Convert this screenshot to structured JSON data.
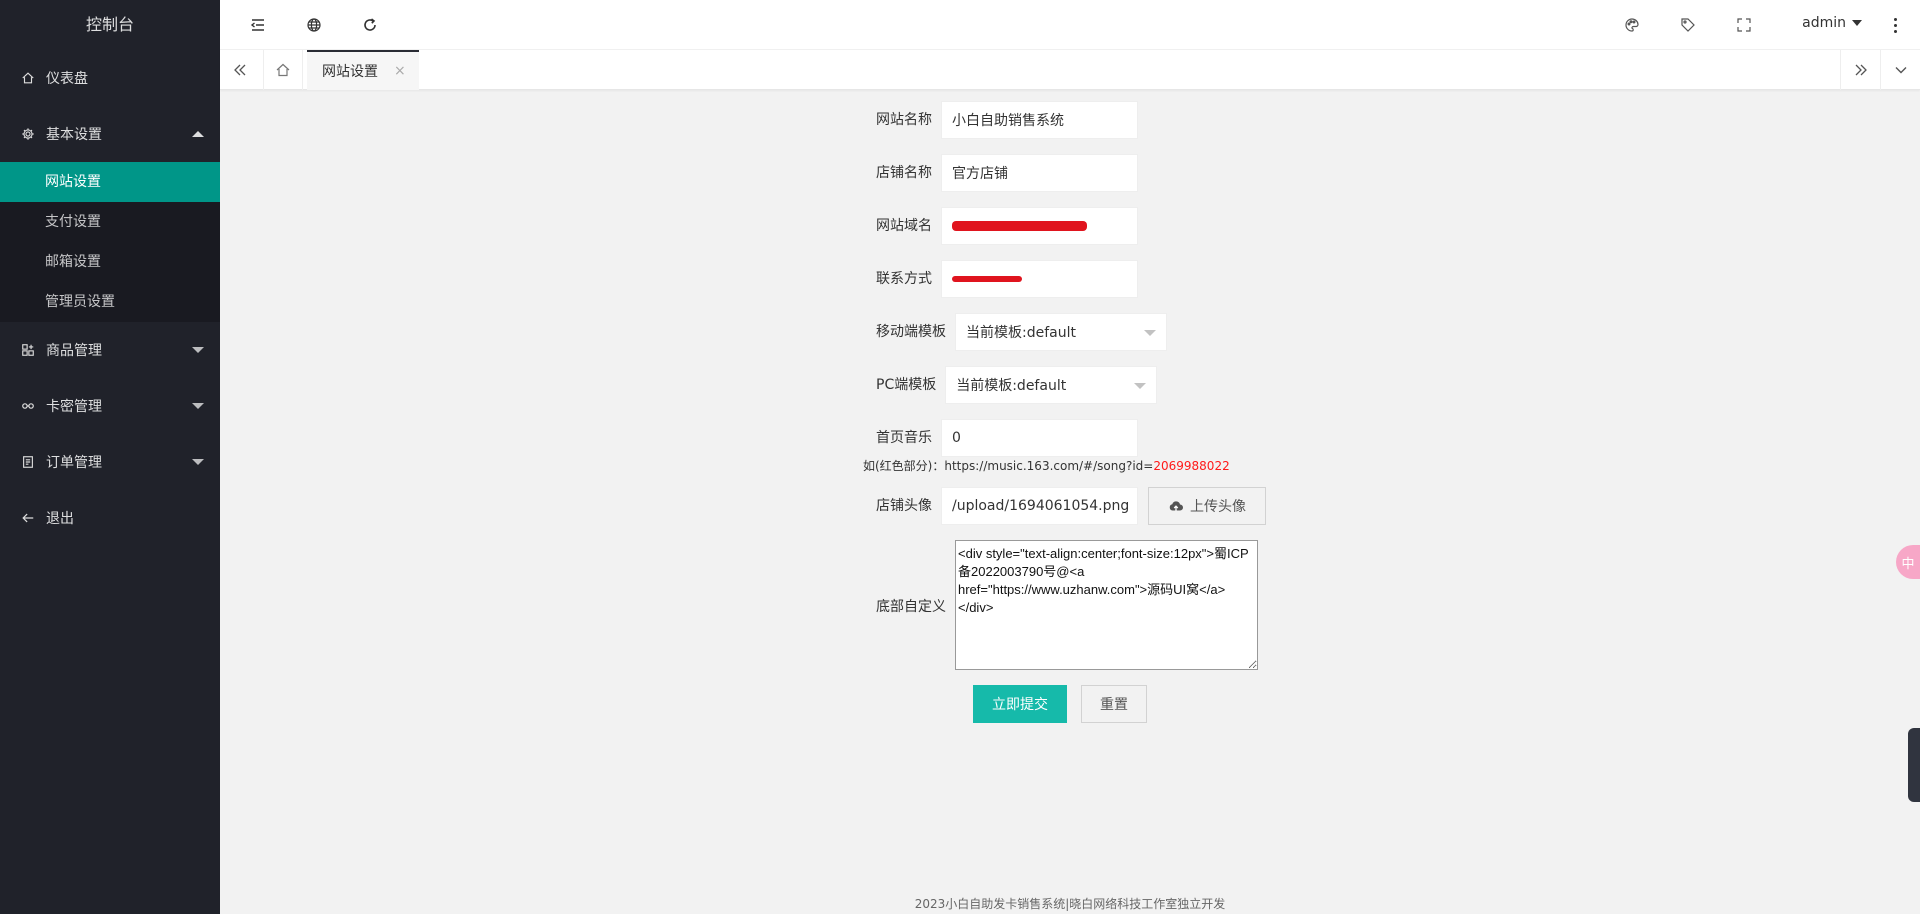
{
  "sidebar": {
    "logo": "控制台",
    "items": [
      {
        "label": "仪表盘",
        "icon": "home-icon"
      },
      {
        "label": "基本设置",
        "icon": "gear-icon"
      },
      {
        "label": "商品管理",
        "icon": "apps-icon"
      },
      {
        "label": "卡密管理",
        "icon": "link-icon"
      },
      {
        "label": "订单管理",
        "icon": "form-icon"
      },
      {
        "label": "退出",
        "icon": "arrow-left-icon"
      }
    ],
    "submenu": [
      {
        "label": "网站设置"
      },
      {
        "label": "支付设置"
      },
      {
        "label": "邮箱设置"
      },
      {
        "label": "管理员设置"
      }
    ]
  },
  "header": {
    "user": "admin"
  },
  "tabs": {
    "active": "网站设置",
    "close": "×"
  },
  "form": {
    "site_name_label": "网站名称",
    "site_name_value": "小白自助销售系统",
    "shop_name_label": "店铺名称",
    "shop_name_value": "官方店铺",
    "domain_label": "网站域名",
    "contact_label": "联系方式",
    "mobile_tpl_label": "移动端模板",
    "mobile_tpl_value": "当前模板:default",
    "pc_tpl_label": "PC端模板",
    "pc_tpl_value": "当前模板:default",
    "music_label": "首页音乐",
    "music_value": "0",
    "music_hint_prefix": "如(红色部分)：https://music.163.com/#/song?id=",
    "music_hint_red": "2069988022",
    "avatar_label": "店铺头像",
    "avatar_value": "/upload/1694061054.png",
    "upload_label": "上传头像",
    "footer_label": "底部自定义",
    "footer_value": "<div style=\"text-align:center;font-size:12px\">蜀ICP备2022003790号@<a href=\"https://www.uzhanw.com\">源码UI窝</a></div>",
    "submit_label": "立即提交",
    "reset_label": "重置"
  },
  "footer": {
    "text": "2023小白自助发卡销售系统|晓白网络科技工作室独立开发"
  },
  "colors": {
    "sidebar_bg": "#20222a",
    "active": "#009688",
    "submit": "#16baaa",
    "hint_red": "#ff1a1a",
    "redaction": "#e0141e"
  }
}
